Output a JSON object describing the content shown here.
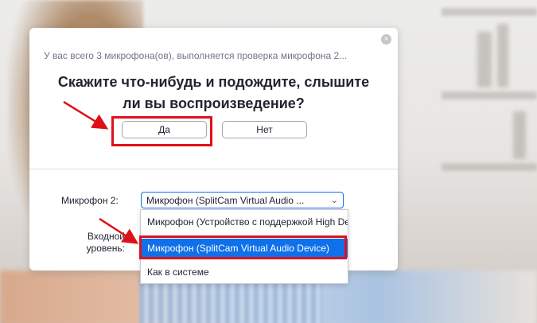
{
  "dialog": {
    "info_text": "У вас всего 3 микрофона(ов), выполняется проверка микрофона 2...",
    "question_line1": "Скажите что-нибудь и подождите, слышите",
    "question_line2": "ли вы воспроизведение?",
    "yes_label": "Да",
    "no_label": "Нет",
    "close_icon": "×",
    "mic_label": "Микрофон 2:",
    "mic_selected": "Микрофон (SplitCam Virtual Audio ...",
    "level_label_line1": "Входной",
    "level_label_line2": "уровень:"
  },
  "dropdown": {
    "options": [
      "Микрофон (Устройство с поддержкой High Definition Audio)",
      "Микрофон (SplitCam Virtual Audio Device)",
      "Как в системе"
    ],
    "selected_index": 1
  },
  "colors": {
    "accent": "#0e71eb",
    "annotation": "#e0101a"
  }
}
